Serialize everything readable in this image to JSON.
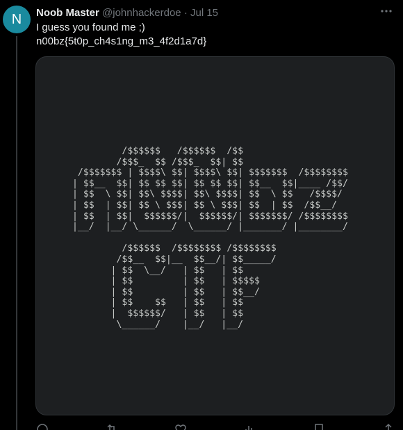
{
  "author": {
    "avatar_letter": "N",
    "avatar_color": "#1a8a9e",
    "display_name": "Noob Master",
    "handle": "@johnhackerdoe",
    "separator": "·",
    "date": "Jul 15"
  },
  "tweet": {
    "line1": "I guess you found me ;)",
    "line2": "n00bz{5t0p_ch4s1ng_m3_4f2d1a7d}"
  },
  "more_icon": "more-horizontal-icon",
  "media": {
    "background": "#1d1f21",
    "ascii_art": "          /$$$$$$   /$$$$$$  /$$\n         /$$$_  $$ /$$$_  $$| $$\n  /$$$$$$$ | $$$$\\ $$| $$$$\\ $$| $$$$$$$  /$$$$$$$$\n | $$__  $$| $$ $$ $$| $$ $$ $$| $$__  $$|____ /$$/\n | $$  \\ $$| $$\\ $$$$| $$\\ $$$$| $$  \\ $$   /$$$$/\n | $$  | $$| $$ \\ $$$| $$ \\ $$$| $$  | $$  /$$__/\n | $$  | $$|  $$$$$$/|  $$$$$$/| $$$$$$$/ /$$$$$$$$\n |__/  |__/ \\______/  \\______/ |_______/ |________/\n\n          /$$$$$$  /$$$$$$$$ /$$$$$$$$\n         /$$__  $$|__  $$__/| $$_____/\n        | $$  \\__/   | $$   | $$\n        | $$         | $$   | $$$$$\n        | $$         | $$   | $$__/\n        | $$    $$   | $$   | $$\n        |  $$$$$$/   | $$   | $$\n         \\______/    |__/   |__/"
  },
  "actions": [
    {
      "name": "reply-icon"
    },
    {
      "name": "repost-icon"
    },
    {
      "name": "like-icon"
    },
    {
      "name": "views-icon"
    },
    {
      "name": "bookmark-icon"
    },
    {
      "name": "share-icon"
    }
  ]
}
